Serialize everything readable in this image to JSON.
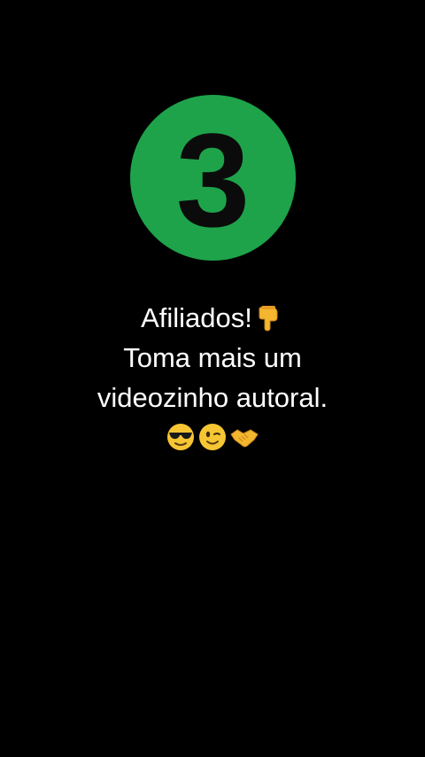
{
  "badge": {
    "number": "3",
    "color": "#1ea34a"
  },
  "caption": {
    "line1": "Afiliados!",
    "line2": "Toma mais um",
    "line3": "videozinho autoral.",
    "emojis": [
      "pointing-down-emoji",
      "sunglasses-face-emoji",
      "winking-face-emoji",
      "handshake-emoji"
    ]
  }
}
